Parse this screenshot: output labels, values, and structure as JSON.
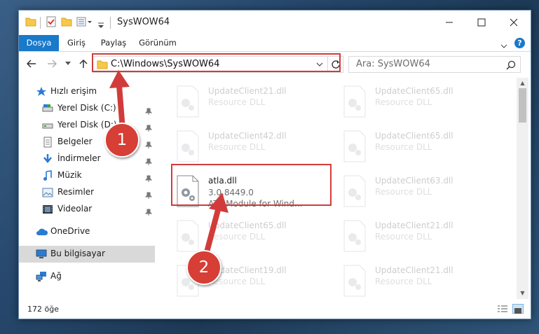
{
  "window": {
    "title": "SysWOW64"
  },
  "ribbon": {
    "tabs": [
      "Dosya",
      "Giriş",
      "Paylaş",
      "Görünüm"
    ],
    "help_label": "?"
  },
  "address": {
    "path": "C:\\Windows\\SysWOW64"
  },
  "search": {
    "placeholder": "Ara: SysWOW64"
  },
  "sidebar": {
    "items": [
      {
        "label": "Hızlı erişim",
        "icon": "star-icon"
      },
      {
        "label": "Yerel Disk (C:)",
        "icon": "drive-icon"
      },
      {
        "label": "Yerel Disk (D:)",
        "icon": "drive-icon"
      },
      {
        "label": "Belgeler",
        "icon": "documents-icon"
      },
      {
        "label": "İndirmeler",
        "icon": "download-icon"
      },
      {
        "label": "Müzik",
        "icon": "music-icon"
      },
      {
        "label": "Resimler",
        "icon": "pictures-icon"
      },
      {
        "label": "Videolar",
        "icon": "video-icon"
      },
      {
        "label": "OneDrive",
        "icon": "cloud-icon"
      },
      {
        "label": "Bu bilgisayar",
        "icon": "computer-icon"
      },
      {
        "label": "Ağ",
        "icon": "network-icon"
      }
    ]
  },
  "files": [
    {
      "name": "UpdateClient21.dll",
      "desc": "Resource DLL"
    },
    {
      "name": "UpdateClient65.dll",
      "desc": "Resource DLL"
    },
    {
      "name": "UpdateClient42.dll",
      "desc": "Resource DLL"
    },
    {
      "name": "UpdateClient65.dll",
      "desc": "Resource DLL"
    },
    {
      "name": "atla.dll",
      "version": "3.0.8449.0",
      "desc": "ATL Module for Wind..."
    },
    {
      "name": "UpdateClient63.dll",
      "desc": "Resource DLL"
    },
    {
      "name": "UpdateClient65.dll",
      "desc": "Resource DLL"
    },
    {
      "name": "UpdateClient21.dll",
      "desc": "Resource DLL"
    },
    {
      "name": "UpdateClient19.dll",
      "desc": "Resource DLL"
    },
    {
      "name": "UpdateClient21.dll",
      "desc": "Resource DLL"
    }
  ],
  "status": {
    "count": "172 öğe"
  },
  "annotations": {
    "step1": "1",
    "step2": "2",
    "color": "#d23b3b"
  },
  "colors": {
    "accent": "#1979ca",
    "highlight_box": "#d23b3b"
  }
}
